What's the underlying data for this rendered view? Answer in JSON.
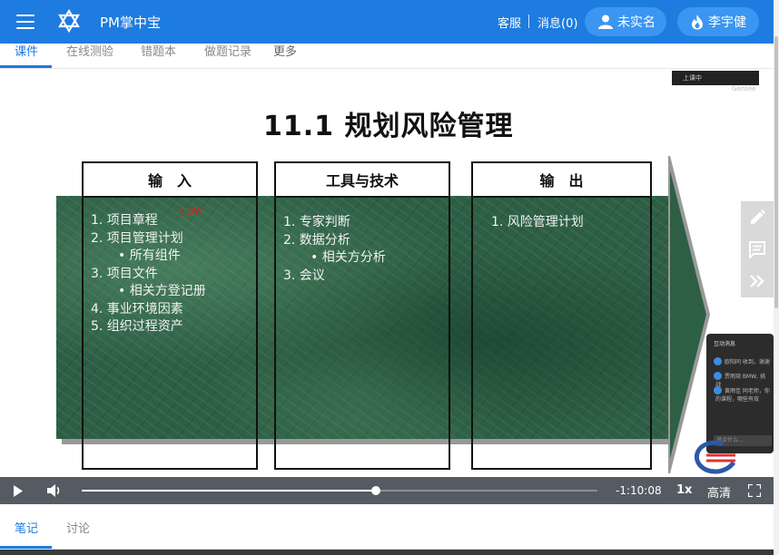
{
  "header": {
    "app_title": "PM掌中宝",
    "service": "客服",
    "messages": "消息(0)",
    "user_status": "未实名",
    "user_name": "李宇健"
  },
  "tabs": [
    {
      "label": "课件",
      "active": true
    },
    {
      "label": "在线测验",
      "active": false
    },
    {
      "label": "错题本",
      "active": false
    },
    {
      "label": "做题记录",
      "active": false
    },
    {
      "label": "更多",
      "active": false
    }
  ],
  "slide": {
    "title": "11.1 规划风险管理",
    "live_badge": "上课中",
    "watermark": "Gensee",
    "annotation": "Low",
    "columns": [
      {
        "header": "输　入",
        "items": [
          {
            "text": "1.  项目章程",
            "sub": false
          },
          {
            "text": "2.  项目管理计划",
            "sub": false
          },
          {
            "text": "•   所有组件",
            "sub": true
          },
          {
            "text": "3.  项目文件",
            "sub": false
          },
          {
            "text": "•   相关方登记册",
            "sub": true
          },
          {
            "text": "4.  事业环境因素",
            "sub": false
          },
          {
            "text": "5.  组织过程资产",
            "sub": false
          }
        ]
      },
      {
        "header": "工具与技术",
        "items": [
          {
            "text": "1.  专家判断",
            "sub": false
          },
          {
            "text": "2.  数据分析",
            "sub": false
          },
          {
            "text": "•   相关方分析",
            "sub": true
          },
          {
            "text": "3.  会议",
            "sub": false
          }
        ]
      },
      {
        "header": "输　出",
        "items": [
          {
            "text": "1.  风险管理计划",
            "sub": false
          }
        ]
      }
    ]
  },
  "chat": {
    "header": "互动消息",
    "rows": [
      "欧阳同 收到，谢谢",
      "贾雨琦 BMW, 挑战",
      "黄雨佳 同老师，你的课程，哪些有效"
    ],
    "input_placeholder": "说点什么..."
  },
  "player": {
    "time_remaining": "-1:10:08",
    "speed": "1x",
    "quality": "高清",
    "progress": 0.57
  },
  "bottom_tabs": [
    {
      "label": "笔记",
      "active": true
    },
    {
      "label": "讨论",
      "active": false
    }
  ],
  "colors": {
    "brand": "#1e7be0",
    "pill": "#3a96f0",
    "player_bar": "#555b62"
  }
}
